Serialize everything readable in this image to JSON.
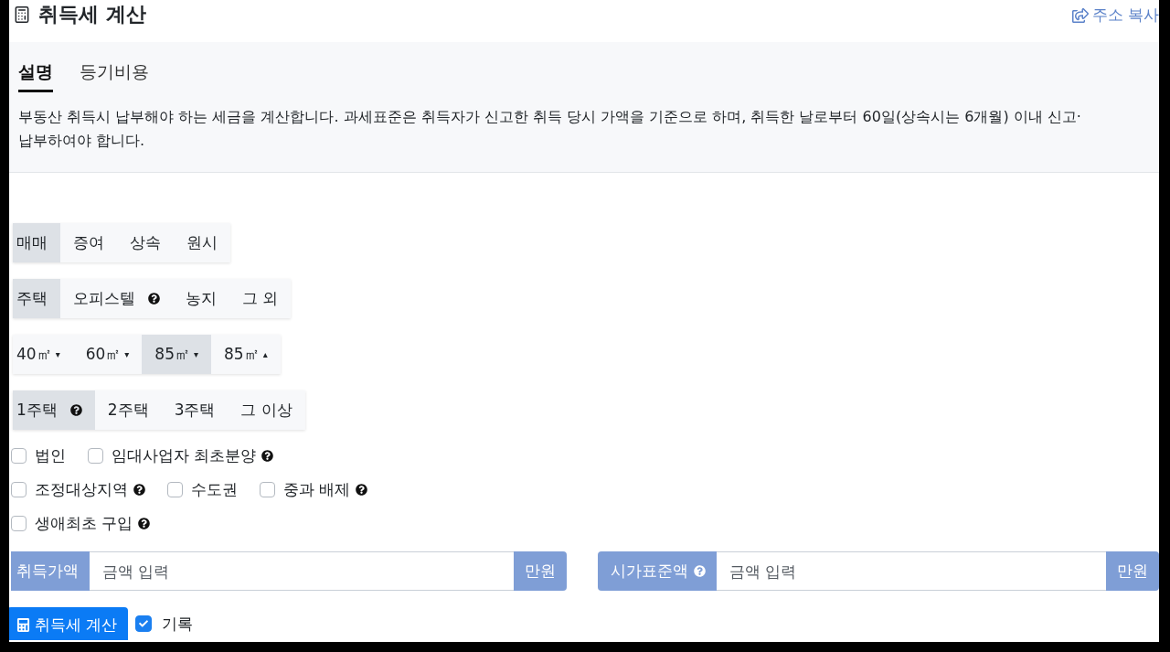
{
  "header": {
    "title": "취득세 계산",
    "copy_link": "주소 복사"
  },
  "tabs": [
    {
      "label": "설명",
      "selected": true
    },
    {
      "label": "등기비용",
      "selected": false
    }
  ],
  "description": "부동산 취득시 납부해야 하는 세금을 계산합니다. 과세표준은 취득자가 신고한 취득 당시 가액을 기준으로 하며, 취득한 날로부터 60일(상속시는 6개월) 이내 신고·납부하여야 합니다.",
  "option_groups": [
    {
      "options": [
        {
          "label": "매매",
          "selected": true,
          "help": false
        },
        {
          "label": "증여",
          "selected": false,
          "help": false
        },
        {
          "label": "상속",
          "selected": false,
          "help": false
        },
        {
          "label": "원시",
          "selected": false,
          "help": false
        }
      ]
    },
    {
      "options": [
        {
          "label": "주택",
          "selected": true,
          "help": false
        },
        {
          "label": "오피스텔",
          "selected": false,
          "help": true
        },
        {
          "label": "농지",
          "selected": false,
          "help": false
        },
        {
          "label": "그 외",
          "selected": false,
          "help": false
        }
      ]
    },
    {
      "options": [
        {
          "label": "40㎡",
          "marker": "▾",
          "selected": false,
          "help": false
        },
        {
          "label": "60㎡",
          "marker": "▾",
          "selected": false,
          "help": false
        },
        {
          "label": "85㎡",
          "marker": "▾",
          "selected": true,
          "help": false
        },
        {
          "label": "85㎡",
          "marker": "▴",
          "selected": false,
          "help": false
        }
      ]
    },
    {
      "options": [
        {
          "label": "1주택",
          "selected": true,
          "help": true
        },
        {
          "label": "2주택",
          "selected": false,
          "help": false
        },
        {
          "label": "3주택",
          "selected": false,
          "help": false
        },
        {
          "label": "그 이상",
          "selected": false,
          "help": false
        }
      ]
    }
  ],
  "checkbox_rows": [
    [
      {
        "label": "법인",
        "checked": false,
        "help": false
      },
      {
        "label": "임대사업자 최초분양",
        "checked": false,
        "help": true
      }
    ],
    [
      {
        "label": "조정대상지역",
        "checked": false,
        "help": true
      },
      {
        "label": "수도권",
        "checked": false,
        "help": false
      },
      {
        "label": "중과 배제",
        "checked": false,
        "help": true
      }
    ],
    [
      {
        "label": "생애최초 구입",
        "checked": false,
        "help": true
      }
    ]
  ],
  "amount_fields": [
    {
      "label": "취득가액",
      "help": false,
      "placeholder": "금액 입력",
      "unit": "만원"
    },
    {
      "label": "시가표준액",
      "help": true,
      "placeholder": "금액 입력",
      "unit": "만원"
    }
  ],
  "submit": {
    "label": "취득세 계산"
  },
  "record": {
    "label": "기록",
    "checked": true
  }
}
